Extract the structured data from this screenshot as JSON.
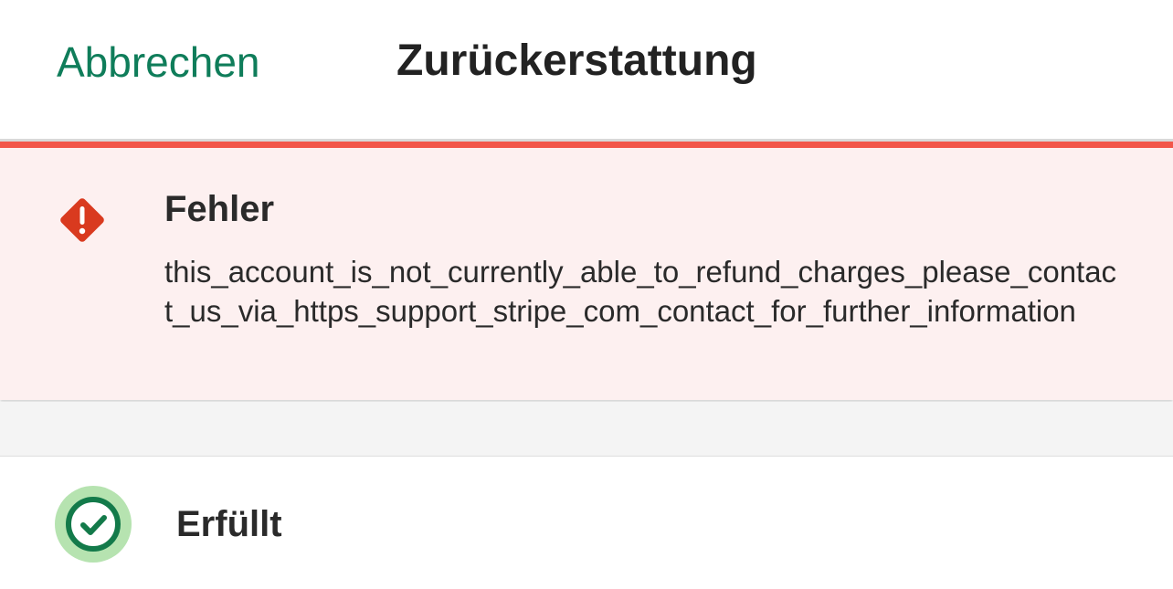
{
  "header": {
    "cancel_label": "Abbrechen",
    "title": "Zurückerstattung"
  },
  "error": {
    "title": "Fehler",
    "message": "this_account_is_not_currently_able_to_refund_charges_please_contact_us_via_https_support_stripe_com_contact_for_further_information",
    "icon": "warning-diamond-icon",
    "accent_color": "#f2564a",
    "icon_color": "#d93a1f",
    "background_color": "#fdf0f0"
  },
  "status": {
    "label": "Erfüllt",
    "icon": "check-circle-icon",
    "icon_color": "#137a4a",
    "icon_bg_color": "#b6e3b0"
  },
  "colors": {
    "accent": "#0f7d5a",
    "text": "#222222"
  }
}
